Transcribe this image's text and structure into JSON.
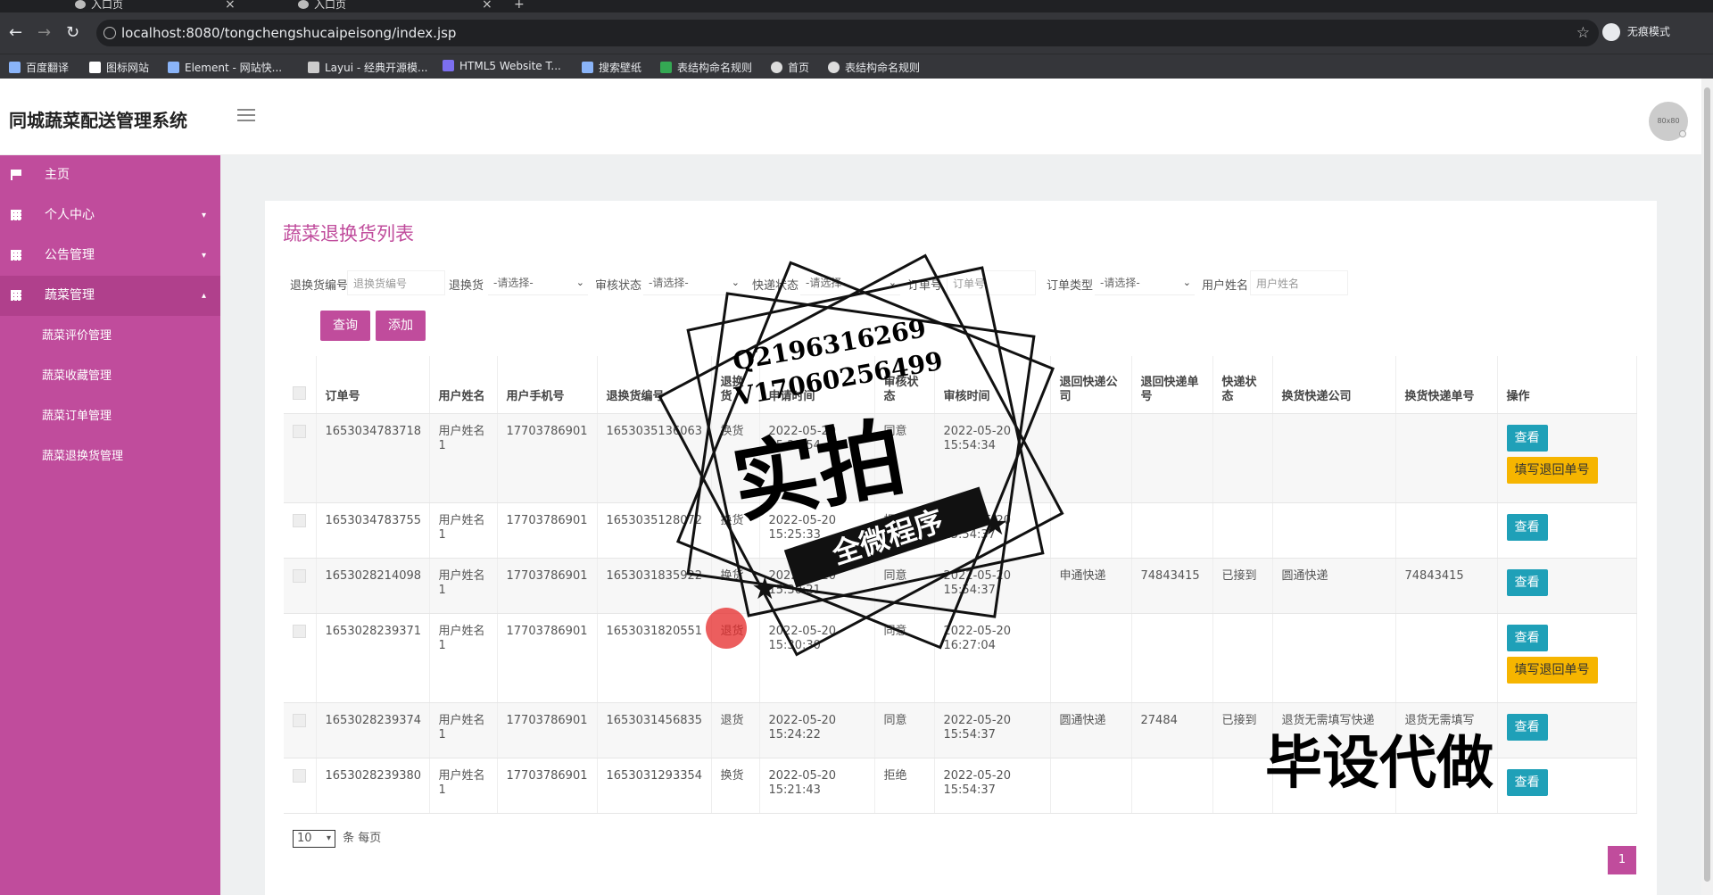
{
  "browser": {
    "tabs": [
      {
        "label": "入口页"
      },
      {
        "label": "入口页"
      }
    ],
    "url": "localhost:8080/tongchengshucaipeisong/index.jsp",
    "incognito_label": "无痕模式",
    "bookmarks": [
      "百度翻译",
      "图标网站",
      "Element - 网站快...",
      "Layui - 经典开源模...",
      "HTML5 Website T...",
      "搜索壁纸",
      "表结构命名规则",
      "首页",
      "表结构命名规则"
    ]
  },
  "app": {
    "title": "同城蔬菜配送管理系统",
    "avatar_text": "80x80"
  },
  "sidebar": {
    "items": [
      {
        "label": "主页",
        "icon": "flag-icon"
      },
      {
        "label": "个人中心",
        "icon": "grid-icon",
        "caret": "▾"
      },
      {
        "label": "公告管理",
        "icon": "grid-icon",
        "caret": "▾"
      },
      {
        "label": "蔬菜管理",
        "icon": "grid-icon",
        "caret": "▴"
      }
    ],
    "subitems": [
      "蔬菜评价管理",
      "蔬菜收藏管理",
      "蔬菜订单管理",
      "蔬菜退换货管理"
    ]
  },
  "page": {
    "title": "蔬菜退换货列表",
    "filters": {
      "exchange_no_label": "退换货编号",
      "exchange_no_placeholder": "退换货编号",
      "type_label": "退换货",
      "type_value": "-请选择-",
      "review_label": "审核状态",
      "review_value": "-请选择-",
      "express_label": "快递状态",
      "express_value": "-请选择-",
      "order_label": "订单号",
      "order_placeholder": "订单号",
      "order_type_label": "订单类型",
      "order_type_value": "-请选择-",
      "user_label": "用户姓名",
      "user_placeholder": "用户姓名"
    },
    "buttons": {
      "query": "查询",
      "add": "添加"
    },
    "table": {
      "headers": [
        "订单号",
        "用户姓名",
        "用户手机号",
        "退换货编号",
        "退换货",
        "申请时间",
        "审核状态",
        "审核时间",
        "退回快递公司",
        "退回快递单号",
        "快递状态",
        "换货快递公司",
        "换货快递单号",
        "操作"
      ],
      "rows": [
        {
          "order": "1653034783718",
          "user": "用户姓名1",
          "phone": "17703786901",
          "no": "1653035136063",
          "type": "换货",
          "apply": "2022-05-20 15:22:54",
          "review": "同意",
          "review_time": "2022-05-20 15:54:34",
          "ret_co": "",
          "ret_no": "",
          "exp": "",
          "ex_co": "",
          "ex_no": "",
          "ops": [
            "查看",
            "填写退回单号"
          ]
        },
        {
          "order": "1653034783755",
          "user": "用户姓名1",
          "phone": "17703786901",
          "no": "1653035128072",
          "type": "换货",
          "apply": "2022-05-20 15:25:33",
          "review": "拒绝",
          "review_time": "2022-05-20 15:54:37",
          "ret_co": "",
          "ret_no": "",
          "exp": "",
          "ex_co": "",
          "ex_no": "",
          "ops": [
            "查看"
          ]
        },
        {
          "order": "1653028214098",
          "user": "用户姓名1",
          "phone": "17703786901",
          "no": "1653031835922",
          "type": "换货",
          "apply": "2022-05-20 15:30:21",
          "review": "同意",
          "review_time": "2022-05-20 15:54:37",
          "ret_co": "申通快递",
          "ret_no": "74843415",
          "exp": "已接到",
          "ex_co": "圆通快递",
          "ex_no": "74843415",
          "ops": [
            "查看"
          ]
        },
        {
          "order": "1653028239371",
          "user": "用户姓名1",
          "phone": "17703786901",
          "no": "1653031820551",
          "type": "退货",
          "apply": "2022-05-20 15:30:30",
          "review": "同意",
          "review_time": "2022-05-20 16:27:04",
          "ret_co": "",
          "ret_no": "",
          "exp": "",
          "ex_co": "",
          "ex_no": "",
          "ops": [
            "查看",
            "填写退回单号"
          ]
        },
        {
          "order": "1653028239374",
          "user": "用户姓名1",
          "phone": "17703786901",
          "no": "1653031456835",
          "type": "退货",
          "apply": "2022-05-20 15:24:22",
          "review": "同意",
          "review_time": "2022-05-20 15:54:37",
          "ret_co": "圆通快递",
          "ret_no": "27484",
          "exp": "已接到",
          "ex_co": "退货无需填写快递",
          "ex_no": "退货无需填写",
          "ops": [
            "查看"
          ]
        },
        {
          "order": "1653028239380",
          "user": "用户姓名1",
          "phone": "17703786901",
          "no": "1653031293354",
          "type": "换货",
          "apply": "2022-05-20 15:21:43",
          "review": "拒绝",
          "review_time": "2022-05-20 15:54:37",
          "ret_co": "",
          "ret_no": "",
          "exp": "",
          "ex_co": "",
          "ex_no": "",
          "ops": [
            "查看"
          ]
        }
      ]
    },
    "pager": {
      "size": "10",
      "suffix": "条 每页",
      "current": "1"
    }
  },
  "watermark": {
    "line1": "Q2196316269",
    "line2": "V17060256499",
    "big": "实拍",
    "band": "全微程序",
    "corner": "毕设代做"
  }
}
